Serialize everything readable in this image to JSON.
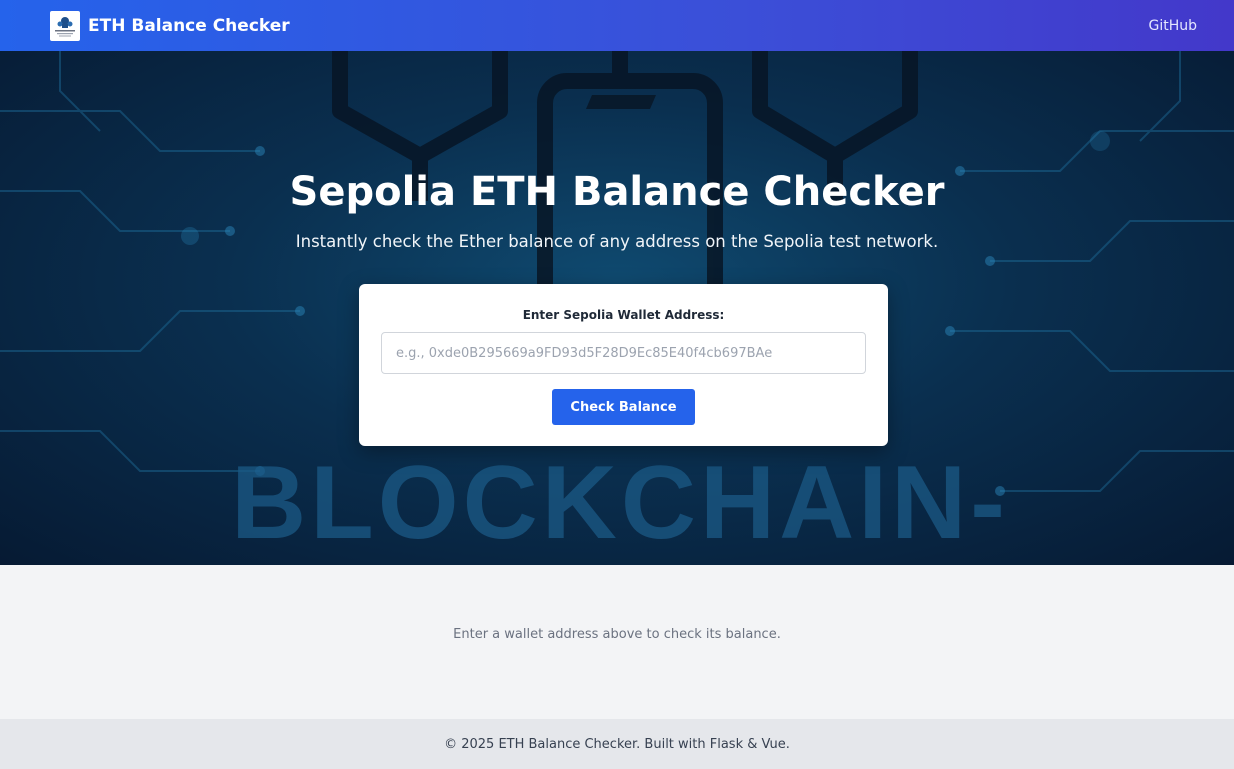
{
  "navbar": {
    "brand_title": "ETH Balance Checker",
    "github_link": "GitHub"
  },
  "hero": {
    "background_watermark": "BLOCKCHAIN-",
    "title": "Sepolia ETH Balance Checker",
    "subtitle": "Instantly check the Ether balance of any address on the Sepolia test network."
  },
  "form": {
    "label": "Enter Sepolia Wallet Address:",
    "input_value": "",
    "input_placeholder": "e.g., 0xde0B295669a9FD93d5F28D9Ec85E40f4cb697BAe",
    "button_label": "Check Balance"
  },
  "result": {
    "message": "Enter a wallet address above to check its balance."
  },
  "footer": {
    "text": "© 2025 ETH Balance Checker. Built with Flask & Vue."
  },
  "colors": {
    "navbar_start": "#2563eb",
    "navbar_end": "#4338ca",
    "primary_button": "#2563eb",
    "hero_dark": "#061a33",
    "footer_bg": "#e5e7eb"
  },
  "icons": {
    "brand_logo": "logo-icon"
  }
}
